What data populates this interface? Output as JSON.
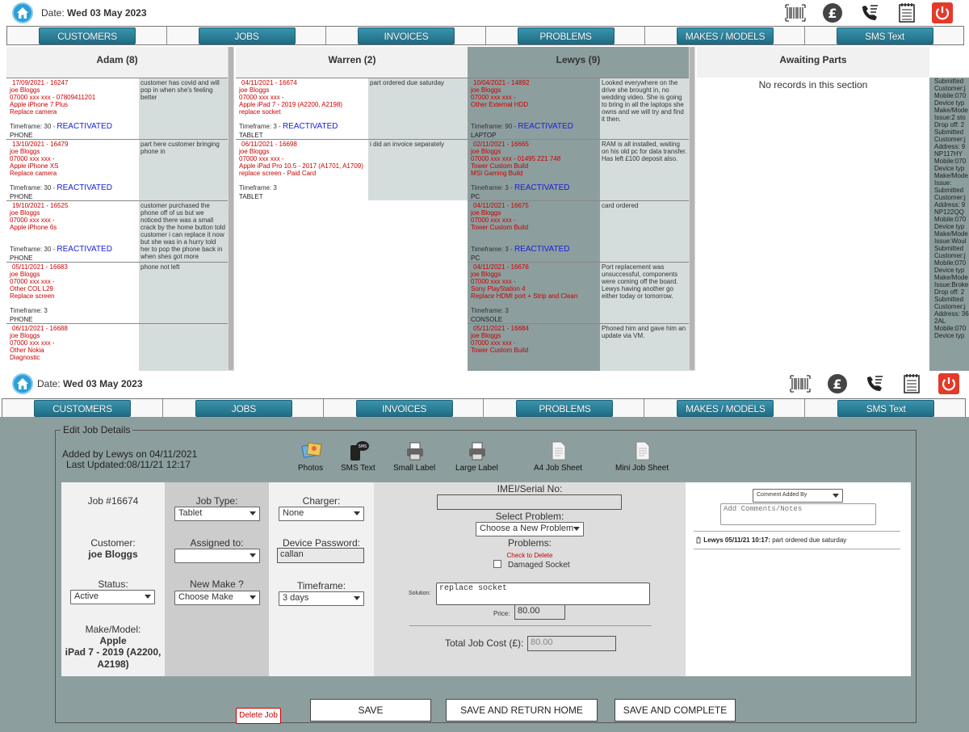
{
  "header": {
    "date_label": "Date:",
    "date_value": "Wed 03 May 2023"
  },
  "icons": [
    "home-icon",
    "barcode-icon",
    "pound-icon",
    "phone-icon",
    "notepad-icon",
    "power-icon"
  ],
  "nav": {
    "tabs": [
      "CUSTOMERS",
      "JOBS",
      "INVOICES",
      "PROBLEMS",
      "MAKES / MODELS",
      "SMS Text"
    ]
  },
  "board": {
    "columns": [
      {
        "title": "Adam (8)",
        "cards": [
          {
            "l1": "17/09/2021 - 16247",
            "l2": "joe Bloggs",
            "l3": "07000 xxx xxx - 07809411201",
            "l4": "Apple iPhone 7 Plus",
            "l5": "Replace camera",
            "tf": "Timeframe: 30 -",
            "re": "REACTIVATED",
            "dv": "PHONE",
            "note": "customer has covid and will pop in when she's feeling better"
          },
          {
            "l1": "13/10/2021 - 16479",
            "l2": "joe Bloggs",
            "l3": "07000 xxx xxx -",
            "l4": "Apple iPhone XS",
            "l5": "Replace camera",
            "tf": "Timeframe: 30 -",
            "re": "REACTIVATED",
            "dv": "PHONE",
            "note": "part here customer bringing phone in"
          },
          {
            "l1": "19/10/2021 - 16525",
            "l2": "joe Bloggs",
            "l3": "07000 xxx xxx -",
            "l4": "Apple iPhone 6s",
            "l5": "",
            "tf": "Timeframe: 30 -",
            "re": "REACTIVATED",
            "dv": "PHONE",
            "note": "customer purchased the phone off of us but we noticed there was a small crack by the home button told customer i can replace it now but she was in a hurry told her to pop the phone back in when shes got more"
          },
          {
            "l1": "05/11/2021 - 16683",
            "l2": "joe Bloggs",
            "l3": "07000 xxx xxx -",
            "l4": "Other COL L29",
            "l5": "Replace screen",
            "tf": "Timeframe: 3",
            "re": "",
            "dv": "PHONE",
            "note": "phone not left"
          },
          {
            "l1": "06/11/2021 - 16688",
            "l2": "joe Bloggs",
            "l3": "07000 xxx xxx -",
            "l4": "Other Nokia",
            "l5": "Diagnostic",
            "tf": "",
            "re": "",
            "dv": "",
            "note": ""
          }
        ]
      },
      {
        "title": "Warren (2)",
        "cards": [
          {
            "l1": "04/11/2021 - 16674",
            "l2": "joe Bloggs",
            "l3": "07000 xxx xxx -",
            "l4": "Apple iPad 7 - 2019 (A2200, A2198)",
            "l5": "replace socket",
            "tf": "Timeframe: 3 -",
            "re": "REACTIVATED",
            "dv": "TABLET",
            "note": "part ordered due saturday"
          },
          {
            "l1": "06/11/2021 - 16698",
            "l2": "joe Bloggs",
            "l3": "07000 xxx xxx -",
            "l4": "Apple iPad Pro 10.5 - 2017 (A1701, A1709)",
            "l5": "replace screen - Paid Card",
            "tf": "Timeframe: 3",
            "re": "",
            "dv": "TABLET",
            "note": "i did an invoice separately"
          }
        ]
      },
      {
        "title": "Lewys (9)",
        "cards": [
          {
            "l1": "10/04/2021 - 14892",
            "l2": "joe Bloggs",
            "l3": "07000 xxx xxx -",
            "l4": "Other External HDD",
            "l5": "",
            "tf": "Timeframe: 90 -",
            "re": "REACTIVATED",
            "dv": "LAPTOP",
            "note": "Looked everywhere on the drive she brought in, no wedding video. She is going to bring in all the laptops she owns and we will try and find it then."
          },
          {
            "l1": "02/11/2021 - 16665",
            "l2": "joe Bloggs",
            "l3": "07000 xxx xxx - 01495 221 748",
            "l4": "Tower Custom Build",
            "l5": "MSI Gaming Build",
            "tf": "Timeframe: 3 -",
            "re": "REACTIVATED",
            "dv": "PC",
            "note": "RAM is all installed, waiting on his old pc for data transfer. Has left £100 deposit also."
          },
          {
            "l1": "04/11/2021 - 16675",
            "l2": "joe Bloggs",
            "l3": "07000 xxx xxx -",
            "l4": "Tower Custom Build",
            "l5": "",
            "tf": "Timeframe: 3 -",
            "re": "REACTIVATED",
            "dv": "PC",
            "note": "card ordered"
          },
          {
            "l1": "04/11/2021 - 16676",
            "l2": "joe Bloggs",
            "l3": "07000 xxx xxx -",
            "l4": "Sony PlayStation 4",
            "l5": "Replace HDMI port + Strip and Clean",
            "tf": "Timeframe: 3",
            "re": "",
            "dv": "CONSOLE",
            "note": "Port replacement was unsuccessful, components were coming off the board. Lewys having another go either today or tomorrow."
          },
          {
            "l1": "05/11/2021 - 16684",
            "l2": "joe Bloggs",
            "l3": "07000 xxx xxx -",
            "l4": "Tower Custom Build",
            "l5": "",
            "tf": "",
            "re": "",
            "dv": "",
            "note": "Phoned him and gave him an update via VM."
          }
        ]
      },
      {
        "title": "Awaiting Parts",
        "empty": "No records in this section"
      }
    ]
  },
  "edit": {
    "legend": "Edit Job Details",
    "added": "Added by Lewys on 04/11/2021",
    "updated": "Last Updated:08/11/21 12:17",
    "tools": [
      "Photos",
      "SMS Text",
      "Small Label",
      "Large Label",
      "A4 Job Sheet",
      "Mini Job Sheet"
    ],
    "job_no": "Job #16674",
    "customer_label": "Customer:",
    "customer": "joe Bloggs",
    "status_label": "Status:",
    "status": "Active",
    "makemodel_label": "Make/Model:",
    "make": "Apple",
    "model": "iPad 7 - 2019 (A2200, A2198)",
    "jobtype_label": "Job Type:",
    "jobtype": "Tablet",
    "assigned_label": "Assigned to:",
    "assigned": "",
    "newmake_label": "New Make ?",
    "newmake": "Choose Make",
    "charger_label": "Charger:",
    "charger": "None",
    "password_label": "Device Password:",
    "password": "callan",
    "timeframe_label": "Timeframe:",
    "timeframe": "3 days",
    "imei_label": "IMEI/Serial No:",
    "imei": "",
    "problem_label": "Select Problem:",
    "problem": "Choose a New Problem",
    "problems_label": "Problems:",
    "check_delete": "Check to Delete",
    "damaged": "Damaged Socket",
    "solution_label": "Solution:",
    "solution": "replace socket",
    "price_label": "Price:",
    "price": "80.00",
    "total_label": "Total Job Cost (£):",
    "total": "80.00",
    "comment_by": "Comment Added By",
    "comment_placeholder": "Add Comments/Notes",
    "comment_author": "Lewys 05/11/21 10:17:",
    "comment_text": "part ordered due saturday",
    "delete": "Delete Job",
    "save": "SAVE",
    "save_home": "SAVE AND RETURN HOME",
    "save_complete": "SAVE AND COMPLETE"
  },
  "right_peek": [
    "Submitted",
    "Customer:j",
    "Mobile:070",
    "Device typ",
    "Make/Mode",
    "Issue:2 sto",
    "Drop off: 2",
    "Submitted",
    "Customer:j",
    "Address: 9",
    "NP117HY",
    "Mobile:070",
    "Device typ",
    "Make/Mode",
    "Issue:",
    "Submitted",
    "Customer:j",
    "Address: 9",
    "NP122QQ",
    "Mobile:070",
    "Device typ",
    "Make/Mode",
    "Issue:Woul",
    "Submitted",
    "Customer:j",
    "Mobile:070",
    "Device typ",
    "Make/Mode",
    "Issue:Broke",
    "Drop off: 2",
    "Submitted",
    "Customer:j",
    "Address: 36",
    "2AL",
    "Mobile:070",
    "Device typ"
  ]
}
